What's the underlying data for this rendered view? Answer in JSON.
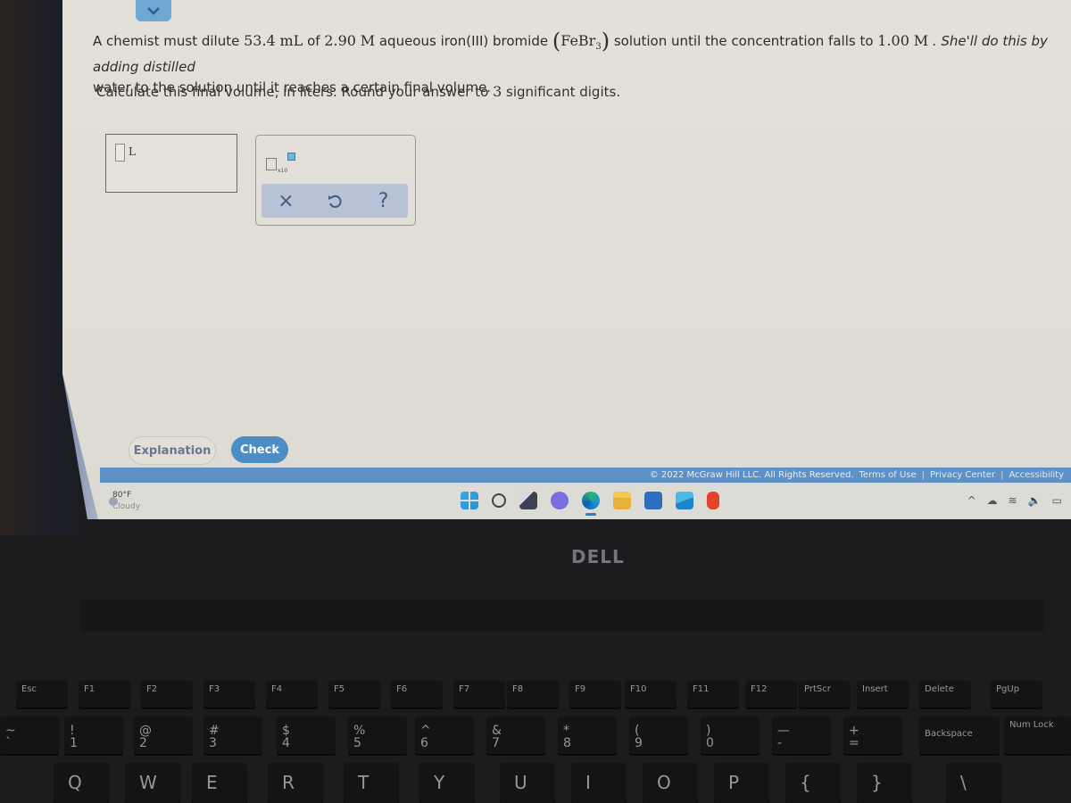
{
  "question": {
    "prefix": "A chemist must dilute ",
    "volume": "53.4",
    "volume_unit": "mL",
    "of": " of ",
    "conc": "2.90",
    "conc_unit": "M",
    "middle": " aqueous iron(III) bromide ",
    "formula_main": "FeBr",
    "formula_sub": "3",
    "after_formula": " solution until the concentration falls to ",
    "final_conc": "1.00",
    "final_conc_unit": "M",
    "tail": " . She'll do this by adding distilled",
    "line2": "water to the solution until it reaches a certain final volume."
  },
  "instruction": {
    "prefix": "Calculate this final volume, in liters. Round your answer to ",
    "sigfigs": "3",
    "suffix": " significant digits."
  },
  "answer": {
    "value": "",
    "unit": "L"
  },
  "tools": {
    "sci_notation_label": "x10",
    "clear_symbol": "×",
    "help_symbol": "?"
  },
  "buttons": {
    "explanation": "Explanation",
    "check": "Check"
  },
  "footer": {
    "copyright": "© 2022 McGraw Hill LLC. All Rights Reserved.",
    "links": [
      "Terms of Use",
      "Privacy Center",
      "Accessibility"
    ],
    "separator": "|"
  },
  "taskbar": {
    "weather_temp": "80°F",
    "weather_desc": "Cloudy",
    "apps": [
      "start",
      "search",
      "task-view",
      "chat",
      "edge",
      "file-explorer",
      "store",
      "mail",
      "office"
    ],
    "tray": [
      "^",
      "☁",
      "≋",
      "🔈",
      "▭"
    ]
  },
  "laptop": {
    "brand": "DELL"
  },
  "keyboard": {
    "fn_row": [
      "Esc",
      "F1",
      "F2",
      "F3",
      "F4",
      "F5",
      "F6",
      "F7",
      "F8",
      "F9",
      "F10",
      "F11",
      "F12",
      "PrtScr",
      "Insert",
      "Delete",
      "PgUp"
    ],
    "num_row_top": [
      "~",
      "!",
      "@",
      "#",
      "$",
      "%",
      "^",
      "&",
      "*",
      "(",
      ")",
      "—",
      "+"
    ],
    "num_row_bottom": [
      "`",
      "1",
      "2",
      "3",
      "4",
      "5",
      "6",
      "7",
      "8",
      "9",
      "0",
      "-",
      "="
    ],
    "backspace": "Backspace",
    "numlock": "Num Lock",
    "letter_row": [
      "Q",
      "W",
      "E",
      "R",
      "T",
      "Y",
      "U",
      "I",
      "O",
      "P",
      "{",
      "}",
      "\\"
    ]
  }
}
